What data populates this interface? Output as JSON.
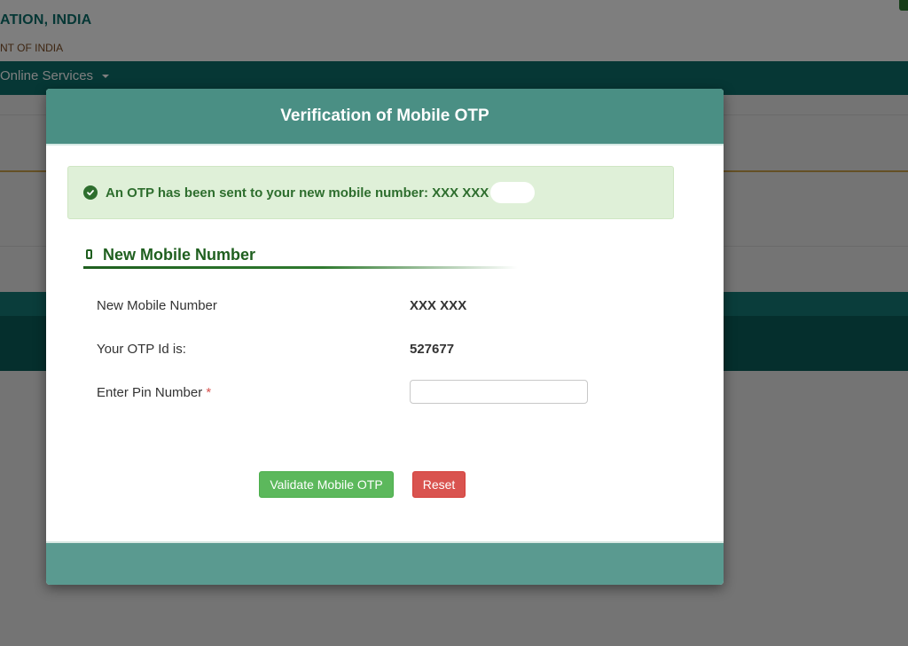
{
  "background": {
    "title": "ATION, INDIA",
    "subtitle": "NT OF INDIA",
    "nav_item": "Online Services"
  },
  "modal": {
    "title": "Verification of Mobile OTP",
    "alert": {
      "icon": "check-circle-icon",
      "text": "An OTP has been sent to your new mobile number: XXX XXX"
    },
    "section": {
      "icon": "mobile-phone-icon",
      "title": "New Mobile Number"
    },
    "fields": {
      "mobile_label": "New Mobile Number",
      "mobile_value": "XXX XXX",
      "otp_id_label": "Your OTP Id is:",
      "otp_id_value": "527677",
      "pin_label": "Enter Pin Number",
      "pin_required_mark": "*",
      "pin_value": ""
    },
    "buttons": {
      "validate": "Validate Mobile OTP",
      "reset": "Reset"
    }
  },
  "colors": {
    "header": "#4a8f84",
    "footer": "#5a9a90",
    "alert_bg": "#dff0d8",
    "alert_text": "#2e6e2e",
    "section_title": "#1f5f1f",
    "validate_button": "#5cb85c",
    "reset_button": "#d9534f",
    "nav": "#0c6e6b"
  }
}
